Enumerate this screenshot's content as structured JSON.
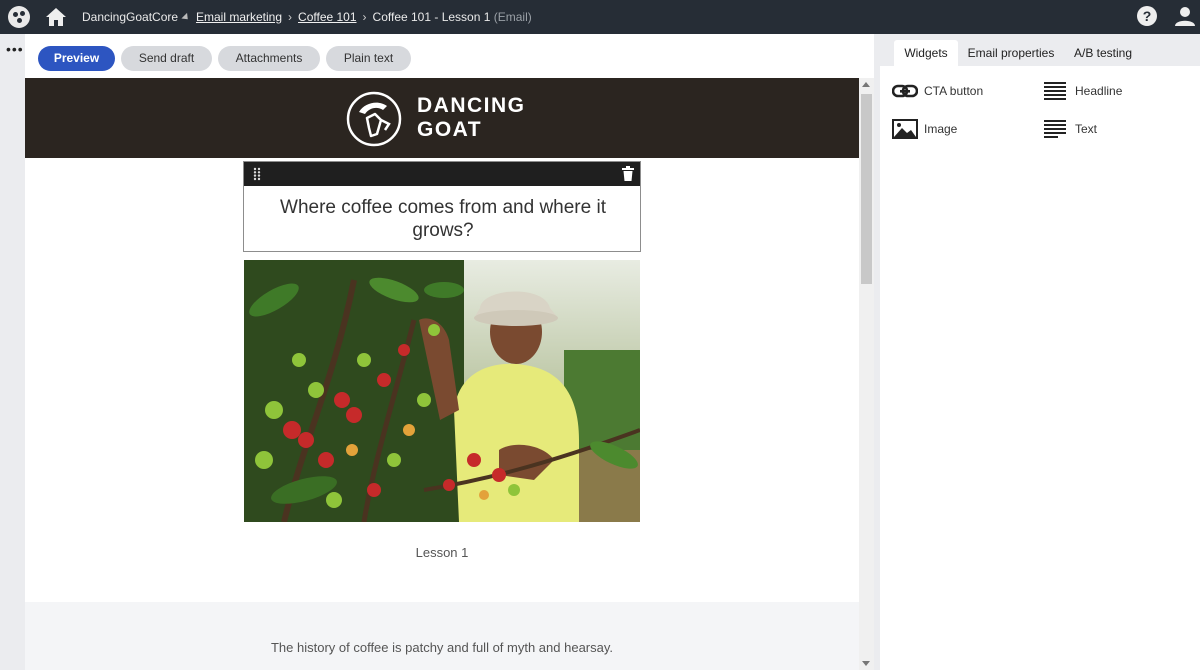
{
  "topbar": {
    "site_name": "DancingGoatCore",
    "breadcrumbs": [
      {
        "label": "Email marketing"
      },
      {
        "label": "Coffee 101"
      },
      {
        "label": "Coffee 101 - Lesson 1"
      }
    ],
    "current_type": "(Email)",
    "help_label": "?"
  },
  "rail": {
    "more_label": "•••"
  },
  "toolbar": {
    "preview": "Preview",
    "send_draft": "Send draft",
    "attachments": "Attachments",
    "plain_text": "Plain text"
  },
  "email": {
    "logo_line1": "DANCING",
    "logo_line2": "GOAT",
    "headline": "Where coffee comes from and where it grows?",
    "image_alt": "Coffee farmer picking coffee cherries",
    "caption": "Lesson 1",
    "body_text": "The history of coffee is patchy and full of myth and hearsay."
  },
  "panel": {
    "tabs": [
      {
        "label": "Widgets",
        "active": true
      },
      {
        "label": "Email properties",
        "active": false
      },
      {
        "label": "A/B testing",
        "active": false
      }
    ],
    "widgets": [
      {
        "label": "CTA button",
        "icon": "link-icon"
      },
      {
        "label": "Headline",
        "icon": "headline-icon"
      },
      {
        "label": "Image",
        "icon": "image-icon"
      },
      {
        "label": "Text",
        "icon": "text-icon"
      }
    ]
  },
  "colors": {
    "topbar_bg": "#262d36",
    "primary_button": "#2d55c1",
    "header_band": "#2b2520"
  }
}
